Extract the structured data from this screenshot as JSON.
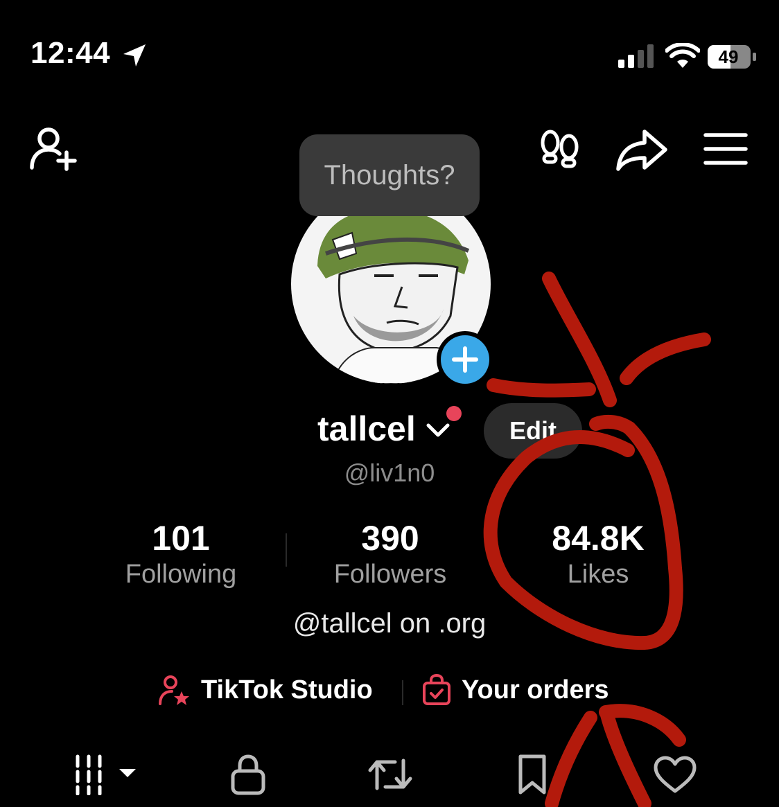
{
  "status_bar": {
    "time": "12:44",
    "battery": "49"
  },
  "tooltip": {
    "text": "Thoughts?"
  },
  "profile": {
    "username": "tallcel",
    "handle": "@liv1n0",
    "edit_label": "Edit",
    "bio": "@tallcel on .org"
  },
  "stats": [
    {
      "value": "101",
      "label": "Following"
    },
    {
      "value": "390",
      "label": "Followers"
    },
    {
      "value": "84.8K",
      "label": "Likes"
    }
  ],
  "links": {
    "studio": "TikTok Studio",
    "orders": "Your orders"
  },
  "colors": {
    "background": "#000000",
    "accent_blue": "#3aa8e8",
    "accent_red": "#e8445a",
    "annotation_red": "#b31a0c"
  },
  "icons": [
    "location-arrow-icon",
    "signal-icon",
    "wifi-icon",
    "battery-icon",
    "add-friend-icon",
    "footprints-icon",
    "share-icon",
    "menu-icon",
    "plus-icon",
    "chevron-down-icon",
    "studio-icon",
    "orders-bag-icon",
    "grid-tab-icon",
    "lock-tab-icon",
    "repost-tab-icon",
    "bookmark-tab-icon",
    "heart-tab-icon"
  ]
}
